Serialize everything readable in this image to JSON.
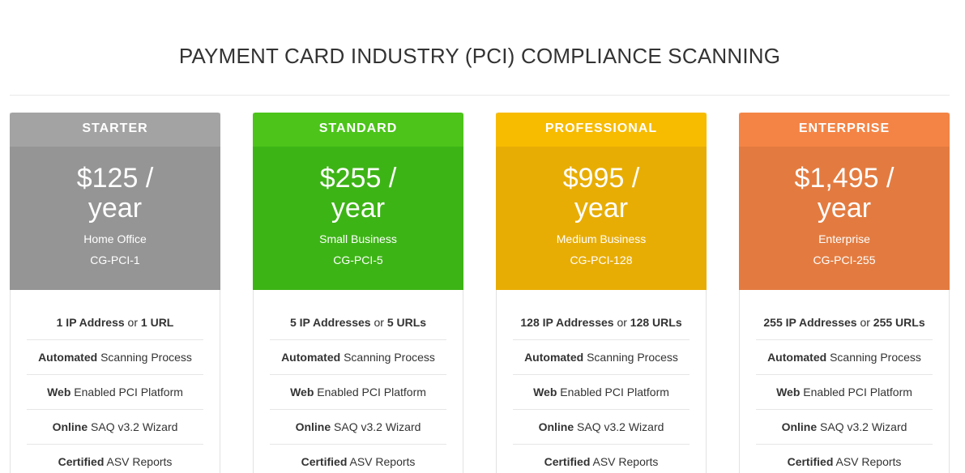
{
  "page": {
    "title": "PAYMENT CARD INDUSTRY (PCI) COMPLIANCE SCANNING"
  },
  "colors": {
    "starter_header": "#a3a3a3",
    "starter_body": "#959595",
    "standard_header": "#4cc41a",
    "standard_body": "#3db416",
    "professional_header": "#f7bb00",
    "professional_body": "#e8ad05",
    "enterprise_header": "#f48445",
    "enterprise_body": "#e37b40"
  },
  "plans": [
    {
      "name": "STARTER",
      "price_line1": "$125 /",
      "price_line2": "year",
      "segment": "Home Office",
      "sku": "CG-PCI-1",
      "features": [
        {
          "bold": "1 IP Address",
          "mid": " or ",
          "bold2": "1 URL"
        },
        {
          "bold": "Automated",
          "mid": " Scanning Process",
          "bold2": ""
        },
        {
          "bold": "Web",
          "mid": " Enabled PCI Platform",
          "bold2": ""
        },
        {
          "bold": "Online",
          "mid": " SAQ v3.2 Wizard",
          "bold2": ""
        },
        {
          "bold": "Certified",
          "mid": " ASV Reports",
          "bold2": ""
        }
      ]
    },
    {
      "name": "STANDARD",
      "price_line1": "$255 /",
      "price_line2": "year",
      "segment": "Small Business",
      "sku": "CG-PCI-5",
      "features": [
        {
          "bold": "5 IP Addresses",
          "mid": " or ",
          "bold2": "5 URLs"
        },
        {
          "bold": "Automated",
          "mid": " Scanning Process",
          "bold2": ""
        },
        {
          "bold": "Web",
          "mid": " Enabled PCI Platform",
          "bold2": ""
        },
        {
          "bold": "Online",
          "mid": " SAQ v3.2 Wizard",
          "bold2": ""
        },
        {
          "bold": "Certified",
          "mid": " ASV Reports",
          "bold2": ""
        }
      ]
    },
    {
      "name": "PROFESSIONAL",
      "price_line1": "$995 /",
      "price_line2": "year",
      "segment": "Medium Business",
      "sku": "CG-PCI-128",
      "features": [
        {
          "bold": "128 IP Addresses",
          "mid": " or ",
          "bold2": "128 URLs"
        },
        {
          "bold": "Automated",
          "mid": " Scanning Process",
          "bold2": ""
        },
        {
          "bold": "Web",
          "mid": " Enabled PCI Platform",
          "bold2": ""
        },
        {
          "bold": "Online",
          "mid": " SAQ v3.2 Wizard",
          "bold2": ""
        },
        {
          "bold": "Certified",
          "mid": " ASV Reports",
          "bold2": ""
        }
      ]
    },
    {
      "name": "ENTERPRISE",
      "price_line1": "$1,495 /",
      "price_line2": "year",
      "segment": "Enterprise",
      "sku": "CG-PCI-255",
      "features": [
        {
          "bold": "255 IP Addresses",
          "mid": " or ",
          "bold2": "255 URLs"
        },
        {
          "bold": "Automated",
          "mid": " Scanning Process",
          "bold2": ""
        },
        {
          "bold": "Web",
          "mid": " Enabled PCI Platform",
          "bold2": ""
        },
        {
          "bold": "Online",
          "mid": " SAQ v3.2 Wizard",
          "bold2": ""
        },
        {
          "bold": "Certified",
          "mid": " ASV Reports",
          "bold2": ""
        }
      ]
    }
  ]
}
